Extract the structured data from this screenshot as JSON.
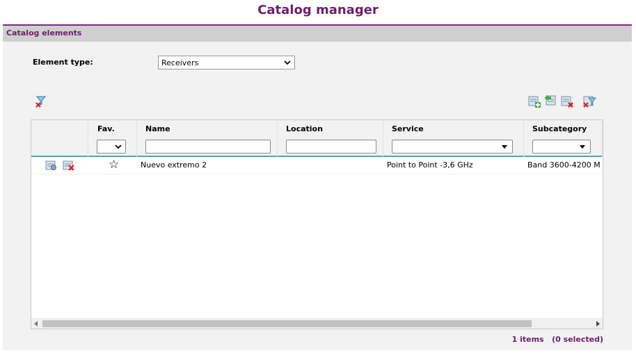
{
  "page": {
    "title": "Catalog manager"
  },
  "panel": {
    "header": "Catalog elements"
  },
  "element_type": {
    "label": "Element type:",
    "selected": "Receivers"
  },
  "toolbar": {
    "clear_filters_icon": "filter-clear-icon",
    "right_icons": [
      "add-element-icon",
      "import-element-icon",
      "delete-element-icon",
      "clear-filter-icon"
    ]
  },
  "grid": {
    "columns": [
      "",
      "Fav.",
      "Name",
      "Location",
      "Service",
      "Subcategory"
    ],
    "rows": [
      {
        "fav": "☆",
        "name": "Nuevo extremo 2",
        "location": "",
        "service": "Point to Point -3,6 GHz",
        "subcategory": "Band 3600-4200 M"
      }
    ]
  },
  "status": {
    "text": "1 items   (0 selected)"
  },
  "colors": {
    "accent": "#6b1f6b",
    "filter_line": "#4fa3c8"
  }
}
